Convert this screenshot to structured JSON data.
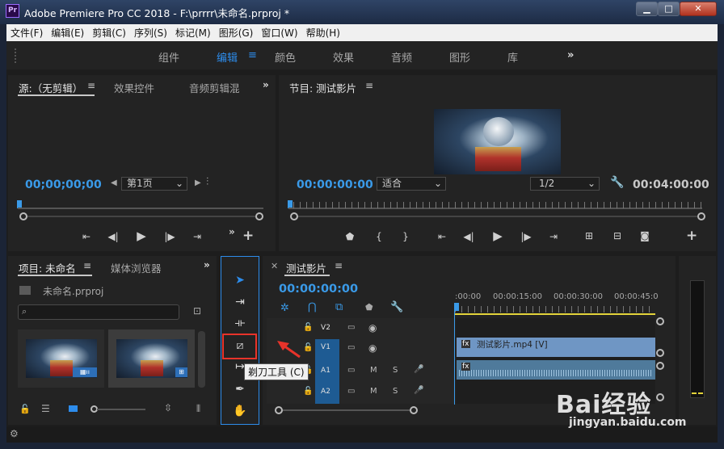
{
  "window": {
    "title": "Adobe Premiere Pro CC 2018 - F:\\prrrr\\未命名.prproj *",
    "app_icon": "Pr",
    "controls": {
      "minimize": "▁",
      "maximize": "□",
      "close": "✕"
    }
  },
  "menu": [
    "文件(F)",
    "编辑(E)",
    "剪辑(C)",
    "序列(S)",
    "标记(M)",
    "图形(G)",
    "窗口(W)",
    "帮助(H)"
  ],
  "workspaces": {
    "tabs": [
      "组件",
      "编辑",
      "颜色",
      "效果",
      "音频",
      "图形",
      "库"
    ],
    "active": "编辑",
    "more": "»",
    "menu_glyph": "≡"
  },
  "source_panel": {
    "tabs": [
      "源:（无剪辑）",
      "效果控件",
      "音频剪辑混"
    ],
    "timecode": "00;00;00;00",
    "page_select": "第1页",
    "more": "»",
    "add": "+"
  },
  "program_panel": {
    "title": "节目: 测试影片",
    "timecode": "00:00:00:00",
    "fit_select": "适合",
    "resolution_select": "1/2",
    "duration": "00:04:00:00",
    "add": "+"
  },
  "project_panel": {
    "tabs": [
      "项目: 未命名",
      "媒体浏览器"
    ],
    "file_name": "未命名.prproj",
    "search_placeholder": "",
    "more": "»"
  },
  "tools_panel": {
    "tooltip": "剃刀工具 (C)"
  },
  "timeline_panel": {
    "sequence": "测试影片",
    "timecode": "00:00:00:00",
    "ruler_labels": [
      ":00:00",
      "00:00:15:00",
      "00:00:30:00",
      "00:00:45:0"
    ],
    "tracks": [
      {
        "label": "V2"
      },
      {
        "label": "V1",
        "clip": "测试影片.mp4 [V]"
      },
      {
        "label": "A1"
      },
      {
        "label": "A2"
      }
    ],
    "track_m": "M",
    "track_s": "S"
  },
  "watermark": {
    "brand": "Bai经验",
    "url": "jingyan.baidu.com"
  },
  "colors": {
    "accent": "#2d8ceb",
    "timecode": "#3a9ae8",
    "clip": "#6f96c4",
    "annotation_arrow": "#e8332a"
  }
}
